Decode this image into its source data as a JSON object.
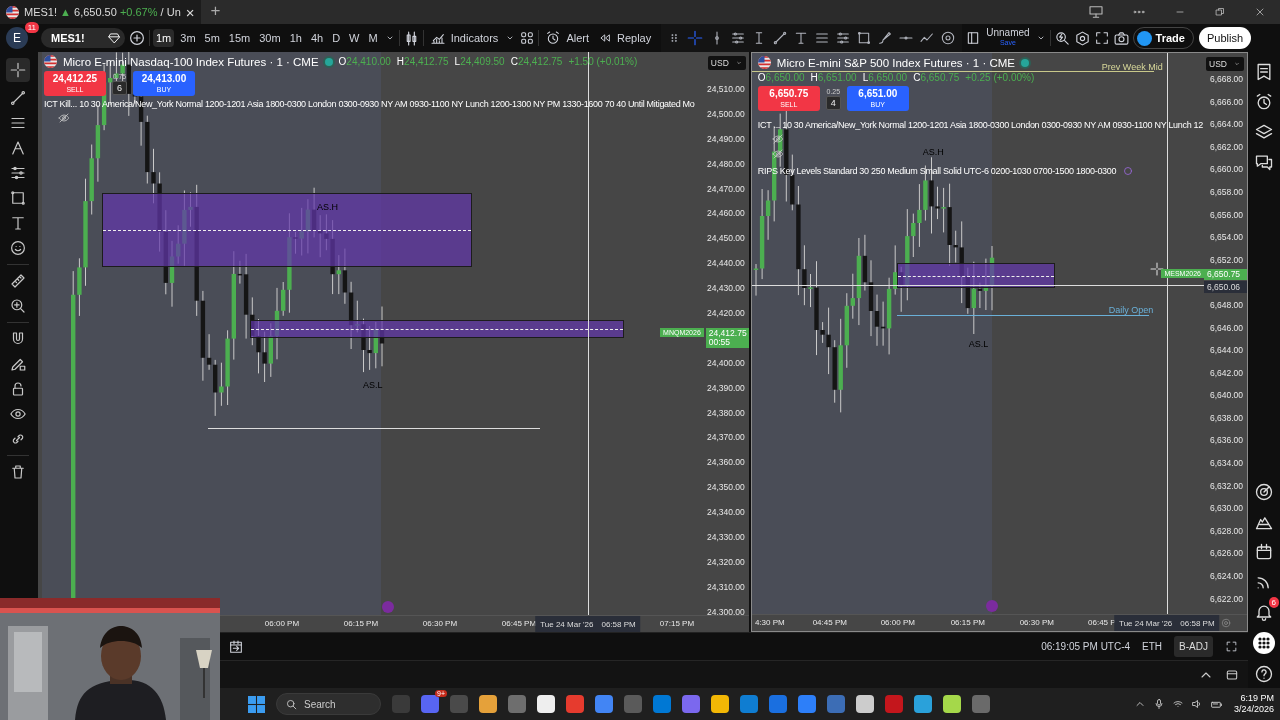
{
  "browser_tab": {
    "symbol": "MES1!",
    "arrow": "▲",
    "price": "6,650.50",
    "change": "+0.67%",
    "suffix": "/ Un",
    "close": "×",
    "new_tab": "+"
  },
  "header": {
    "avatar": "E",
    "badge": "11",
    "symbol": "MES1!",
    "intervals": [
      {
        "label": "1m",
        "selected": true
      },
      {
        "label": "3m",
        "selected": false
      },
      {
        "label": "5m",
        "selected": false
      },
      {
        "label": "15m",
        "selected": false
      },
      {
        "label": "30m",
        "selected": false
      },
      {
        "label": "1h",
        "selected": false
      },
      {
        "label": "4h",
        "selected": false
      },
      {
        "label": "D",
        "selected": false
      },
      {
        "label": "W",
        "selected": false
      },
      {
        "label": "M",
        "selected": false
      }
    ],
    "indicators": "Indicators",
    "alert": "Alert",
    "replay": "Replay",
    "layout": "Unnamed",
    "save": "Save",
    "trade": "Trade",
    "publish": "Publish"
  },
  "charts": [
    {
      "title": "Micro E-mini Nasdaq-100 Index Futures · 1 · CME",
      "ohlc": [
        {
          "key": "O",
          "value": "24,410.00"
        },
        {
          "key": "H",
          "value": "24,412.75"
        },
        {
          "key": "L",
          "value": "24,409.50"
        },
        {
          "key": "C",
          "value": "24,412.75"
        }
      ],
      "change": "+1.50 (+0.01%)",
      "sell": {
        "price": "24,412.25",
        "label": "SELL"
      },
      "spread": "0.75",
      "quantity": "6",
      "buy": {
        "price": "24,413.00",
        "label": "BUY"
      },
      "indicators": [
        "ICT Kill... 10 30 America/New_York Normal 1200-1201 Asia 1800-0300 London 0300-0930 NY AM 0930-1100 NY Lunch 1200-1300 NY PM 1330-1600 70 40 Until Mitigated Mo"
      ],
      "currency": "USD",
      "price_ticks": [
        "24,510.00",
        "24,500.00",
        "24,490.00",
        "24,480.00",
        "24,470.00",
        "24,460.00",
        "24,450.00",
        "24,440.00",
        "24,430.00",
        "24,420.00",
        "24,400.00",
        "24,390.00",
        "24,380.00",
        "24,370.00",
        "24,360.00",
        "24,350.00",
        "24,340.00",
        "24,330.00",
        "24,320.00",
        "24,310.00",
        "24,300.00"
      ],
      "last_price": {
        "symbol": "MNQM2026",
        "price": "24,412.75",
        "countdown": "00:55"
      },
      "levels": [
        {
          "kind": "session_high",
          "label": "AS.H"
        },
        {
          "kind": "session_low",
          "label": "AS.L"
        }
      ],
      "time_ticks": [
        "06:00 PM",
        "06:15 PM",
        "06:30 PM",
        "06:45 PM",
        "07:15 PM"
      ],
      "crosshair_time": {
        "date": "Tue 24 Mar '26",
        "time": "06:58 PM"
      }
    },
    {
      "title": "Micro E-mini S&P 500 Index Futures · 1 · CME",
      "ohlc": [
        {
          "key": "O",
          "value": "6,650.00"
        },
        {
          "key": "H",
          "value": "6,651.00"
        },
        {
          "key": "L",
          "value": "6,650.00"
        },
        {
          "key": "C",
          "value": "6,650.75"
        }
      ],
      "change": "+0.25 (+0.00%)",
      "sell": {
        "price": "6,650.75",
        "label": "SELL"
      },
      "spread": "0.25",
      "quantity": "4",
      "buy": {
        "price": "6,651.00",
        "label": "BUY"
      },
      "indicators": [
        "ICT ... 10 30 America/New_York Normal 1200-1201 Asia 1800-0300 London 0300-0930 NY AM 0930-1100 NY Lunch 12",
        "RIPS Key Levels Standard 30 250 Medium Small Solid UTC-6 0200-1030 0700-1500 1800-0300"
      ],
      "currency": "USD",
      "price_ticks": [
        "6,668.00",
        "6,666.00",
        "6,664.00",
        "6,662.00",
        "6,660.00",
        "6,658.00",
        "6,656.00",
        "6,654.00",
        "6,652.00",
        "6,648.00",
        "6,646.00",
        "6,644.00",
        "6,642.00",
        "6,640.00",
        "6,638.00",
        "6,636.00",
        "6,634.00",
        "6,632.00",
        "6,630.00",
        "6,628.00",
        "6,626.00",
        "6,624.00",
        "6,622.00"
      ],
      "last_price": {
        "symbol": "MESM2026",
        "price": "6,650.75"
      },
      "crosshair_price": "6,650.06",
      "levels": [
        {
          "kind": "prev_week_mid",
          "label": "Prev Week Mid"
        },
        {
          "kind": "session_high",
          "label": "AS.H"
        },
        {
          "kind": "daily_open",
          "label": "Daily Open"
        },
        {
          "kind": "session_low",
          "label": "AS.L"
        }
      ],
      "time_ticks": [
        "4:30 PM",
        "04:45 PM",
        "06:00 PM",
        "06:15 PM",
        "06:30 PM",
        "06:45 P"
      ],
      "crosshair_time": {
        "date": "Tue 24 Mar '26",
        "time": "06:58 PM"
      }
    }
  ],
  "bottom_bar": {
    "clock": "06:19:05 PM UTC-4",
    "session": "ETH",
    "adjust": "B-ADJ"
  },
  "sidebar": {
    "notifications": "6"
  },
  "taskbar": {
    "search": "Search",
    "chat_badge": "9+",
    "time": "6:19 PM",
    "date": "3/24/2026"
  }
}
